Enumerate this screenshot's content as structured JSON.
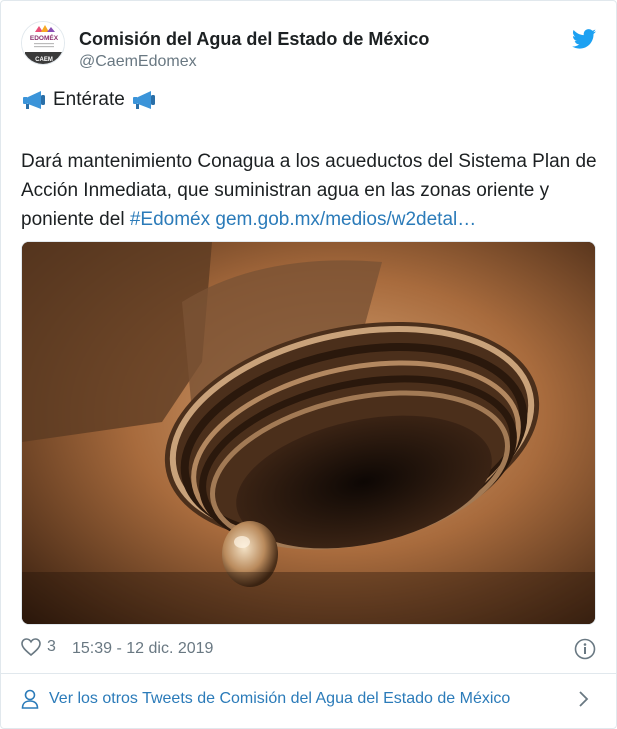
{
  "author": {
    "display_name": "Comisión del Agua del Estado de México",
    "handle": "@CaemEdomex",
    "avatar_text": {
      "brand": "EDOMÉX",
      "sub": "CAEM"
    }
  },
  "tweet": {
    "headline": "Entérate",
    "text": "Dará mantenimiento Conagua a los acueductos del Sistema Plan de Acción Inmediata, que suministran agua en las zonas oriente y poniente del ",
    "hashtag": "#Edoméx",
    "url": "gem.gob.mx/medios/w2detal…"
  },
  "meta": {
    "likes": "3",
    "timestamp": "15:39 - 12 dic. 2019"
  },
  "footer": {
    "more_tweets": "Ver los otros Tweets de Comisión del Agua del Estado de México"
  },
  "colors": {
    "link": "#2b7bb9",
    "muted": "#697882",
    "twitter_blue": "#1da1f2",
    "megaphone": "#3b94d9"
  },
  "icons": [
    "twitter-logo-icon",
    "megaphone-icon",
    "heart-icon",
    "info-icon",
    "person-icon",
    "chevron-right-icon"
  ]
}
